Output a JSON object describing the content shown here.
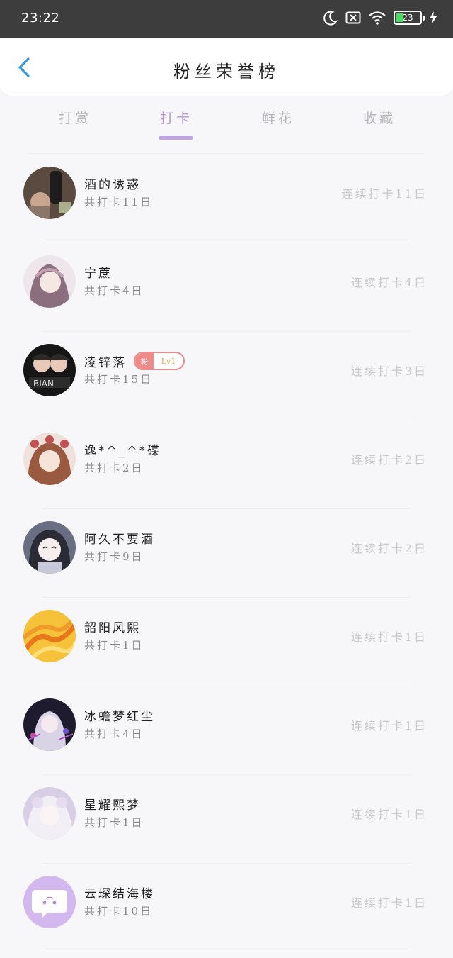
{
  "status_bar": {
    "time": "23:22",
    "battery_level": "23",
    "icons": [
      "moon-icon",
      "sim-disabled-icon",
      "wifi-icon",
      "battery-icon",
      "charging-icon"
    ]
  },
  "header": {
    "title": "粉丝荣誉榜",
    "back_icon": "chevron-left-icon"
  },
  "colors": {
    "accent": "#b69ad8",
    "back": "#2f9be6",
    "badge": "#ef8a8a",
    "status_bar": "#3d3d3d"
  },
  "tabs": [
    {
      "label": "打赏",
      "active": false
    },
    {
      "label": "打卡",
      "active": true
    },
    {
      "label": "鲜花",
      "active": false
    },
    {
      "label": "收藏",
      "active": false
    }
  ],
  "fans": [
    {
      "name": "酒的诱惑",
      "total": "共打卡11日",
      "streak": "连续打卡11日"
    },
    {
      "name": "宁蔗",
      "total": "共打卡4日",
      "streak": "连续打卡4日"
    },
    {
      "name": "凌锌落",
      "total": "共打卡15日",
      "streak": "连续打卡3日",
      "badge": {
        "left": "粉",
        "right": "Lv1"
      }
    },
    {
      "name": "逸*^_^*碟",
      "total": "共打卡2日",
      "streak": "连续打卡2日"
    },
    {
      "name": "阿久不要酒",
      "total": "共打卡9日",
      "streak": "连续打卡2日"
    },
    {
      "name": "韶阳风熙",
      "total": "共打卡1日",
      "streak": "连续打卡1日"
    },
    {
      "name": "冰蟾梦红尘",
      "total": "共打卡4日",
      "streak": "连续打卡1日"
    },
    {
      "name": "星耀熙梦",
      "total": "共打卡1日",
      "streak": "连续打卡1日"
    },
    {
      "name": "云琛结海楼",
      "total": "共打卡10日",
      "streak": "连续打卡1日"
    }
  ]
}
